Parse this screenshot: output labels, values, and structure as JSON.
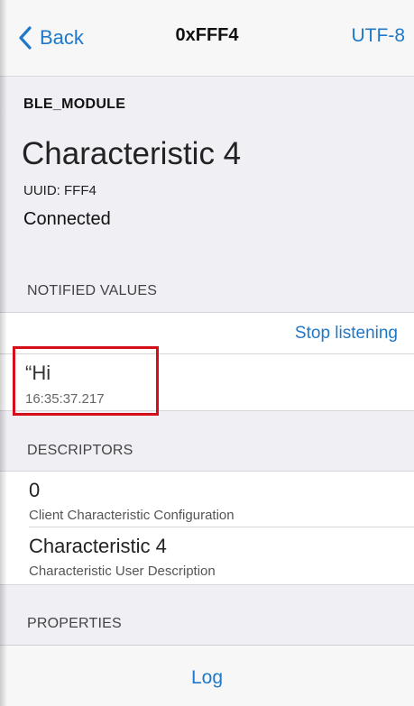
{
  "nav": {
    "back_label": "Back",
    "title": "0xFFF4",
    "encoding": "UTF-8"
  },
  "header": {
    "module_name": "BLE_MODULE",
    "characteristic_name": "Characteristic 4",
    "uuid": "UUID: FFF4",
    "status": "Connected"
  },
  "notified": {
    "section_label": "NOTIFIED VALUES",
    "stop_label": "Stop listening",
    "values": [
      {
        "value": "“Hi",
        "timestamp": "16:35:37.217"
      }
    ]
  },
  "descriptors": {
    "section_label": "DESCRIPTORS",
    "items": [
      {
        "value": "0",
        "name": "Client Characteristic Configuration"
      },
      {
        "value": "Characteristic 4",
        "name": "Characteristic User Description"
      }
    ]
  },
  "properties": {
    "section_label": "PROPERTIES"
  },
  "footer": {
    "log_label": "Log"
  },
  "colors": {
    "accent": "#1f78c8",
    "highlight": "#d40f1a",
    "background": "#efeff4"
  }
}
